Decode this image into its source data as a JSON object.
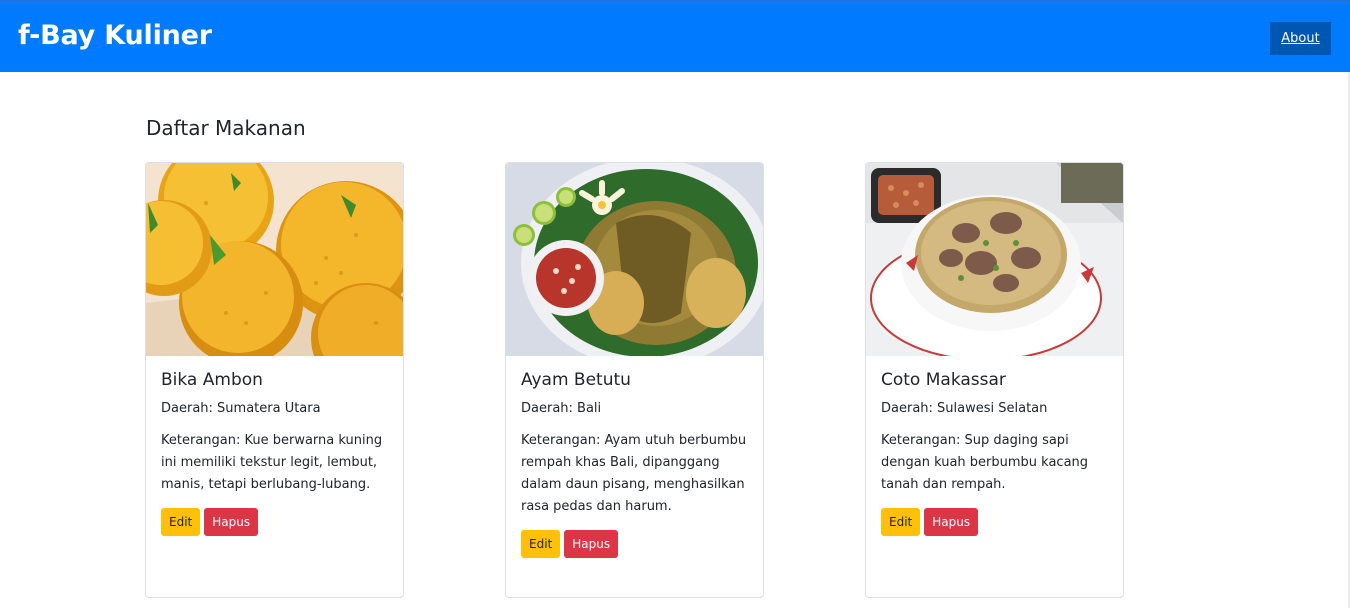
{
  "navbar": {
    "brand": "f-Bay Kuliner",
    "about_label": "About"
  },
  "main": {
    "heading": "Daftar Makanan"
  },
  "cards": [
    {
      "title": "Bika Ambon",
      "region": "Daerah: Sumatera Utara",
      "description": "Keterangan: Kue berwarna kuning ini memiliki tekstur legit, lembut, manis, tetapi berlubang-lubang.",
      "edit_label": "Edit",
      "delete_label": "Hapus"
    },
    {
      "title": "Ayam Betutu",
      "region": "Daerah: Bali",
      "description": "Keterangan: Ayam utuh berbumbu rempah khas Bali, dipanggang dalam daun pisang, menghasilkan rasa pedas dan harum.",
      "edit_label": "Edit",
      "delete_label": "Hapus"
    },
    {
      "title": "Coto Makassar",
      "region": "Daerah: Sulawesi Selatan",
      "description": "Keterangan: Sup daging sapi dengan kuah berbumbu kacang tanah dan rempah.",
      "edit_label": "Edit",
      "delete_label": "Hapus"
    }
  ]
}
